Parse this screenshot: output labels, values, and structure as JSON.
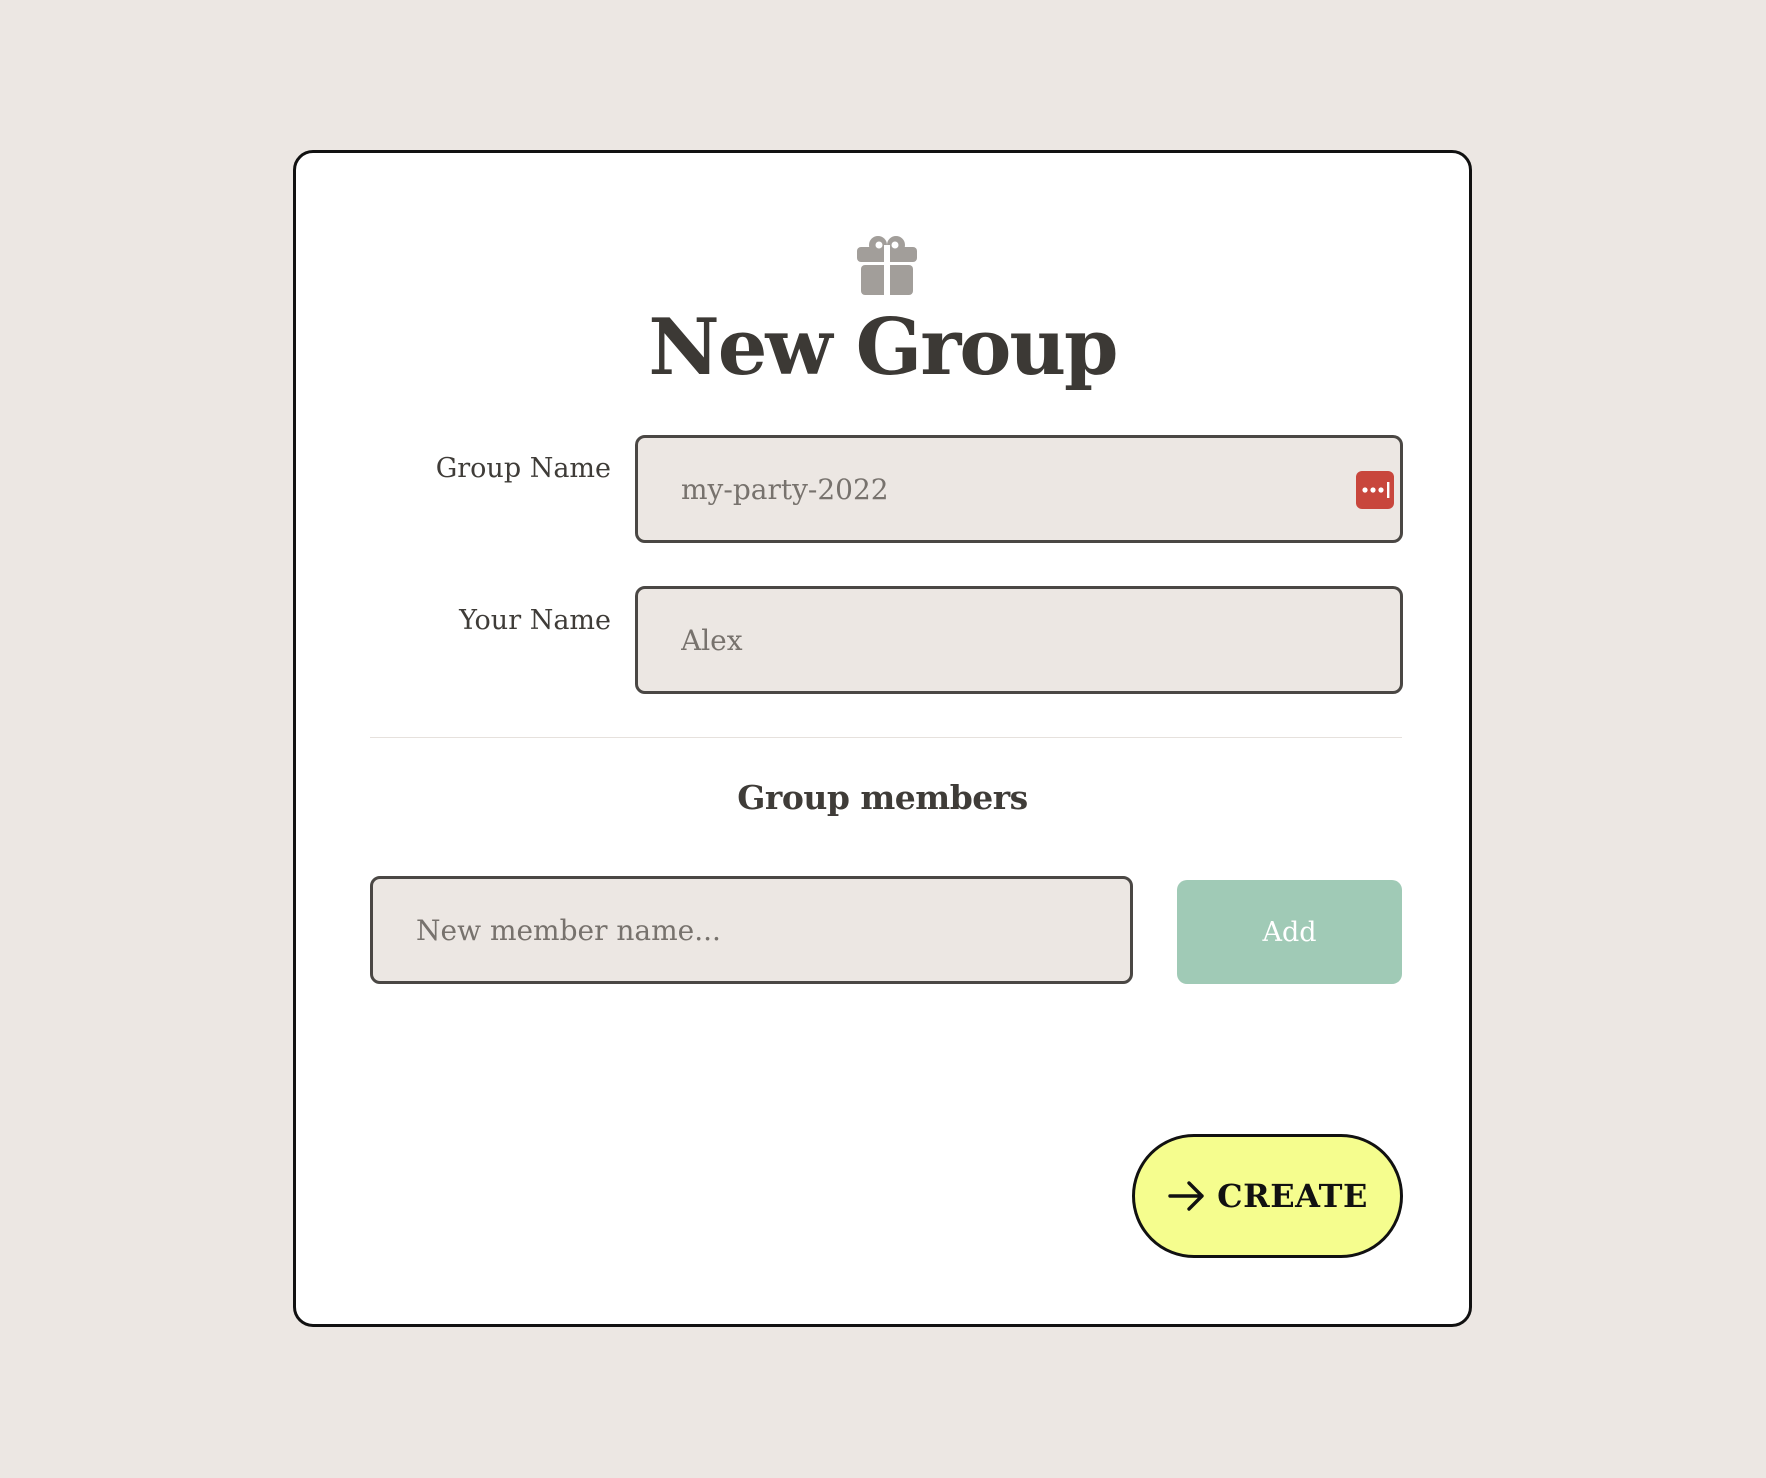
{
  "title": "New Group",
  "form": {
    "group_name": {
      "label": "Group Name",
      "value": "",
      "placeholder": "my-party-2022"
    },
    "your_name": {
      "label": "Your Name",
      "value": "",
      "placeholder": "Alex"
    }
  },
  "members": {
    "section_title": "Group members",
    "new_member_placeholder": "New member name...",
    "add_label": "Add"
  },
  "create": {
    "label": "CREATE"
  },
  "icons": {
    "header": "gift-icon",
    "password_manager": "password-manager-icon",
    "create": "arrow-right-icon"
  },
  "colors": {
    "background": "#ece7e3",
    "card": "#ffffff",
    "input_background": "#ece7e3",
    "add_button": "#a0cab6",
    "create_button": "#f5fd8e",
    "password_icon": "#c8463c",
    "text": "#3f3c38"
  }
}
